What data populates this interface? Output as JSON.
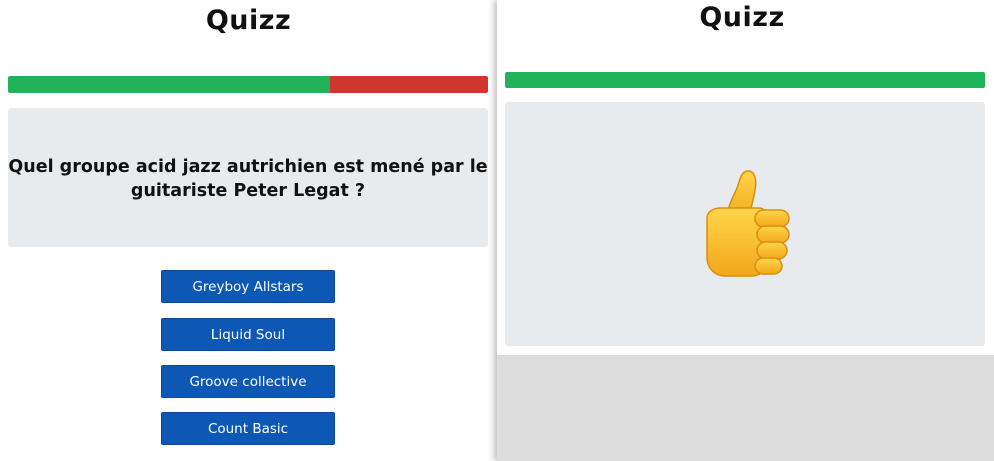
{
  "left": {
    "title": "Quizz",
    "progress": {
      "correct_fraction": 0.67,
      "wrong_fraction": 0.33,
      "correct_color": "#22b25a",
      "wrong_color": "#d0362e"
    },
    "question": "Quel groupe acid jazz autrichien est mené par le guitariste Peter Legat ?",
    "answers": [
      "Greyboy Allstars",
      "Liquid Soul",
      "Groove collective",
      "Count Basic"
    ],
    "button_color": "#0d57b5"
  },
  "right": {
    "title": "Quizz",
    "progress": {
      "correct_fraction": 1.0,
      "correct_color": "#22b25a"
    },
    "result_icon": "thumbs-up-icon"
  }
}
